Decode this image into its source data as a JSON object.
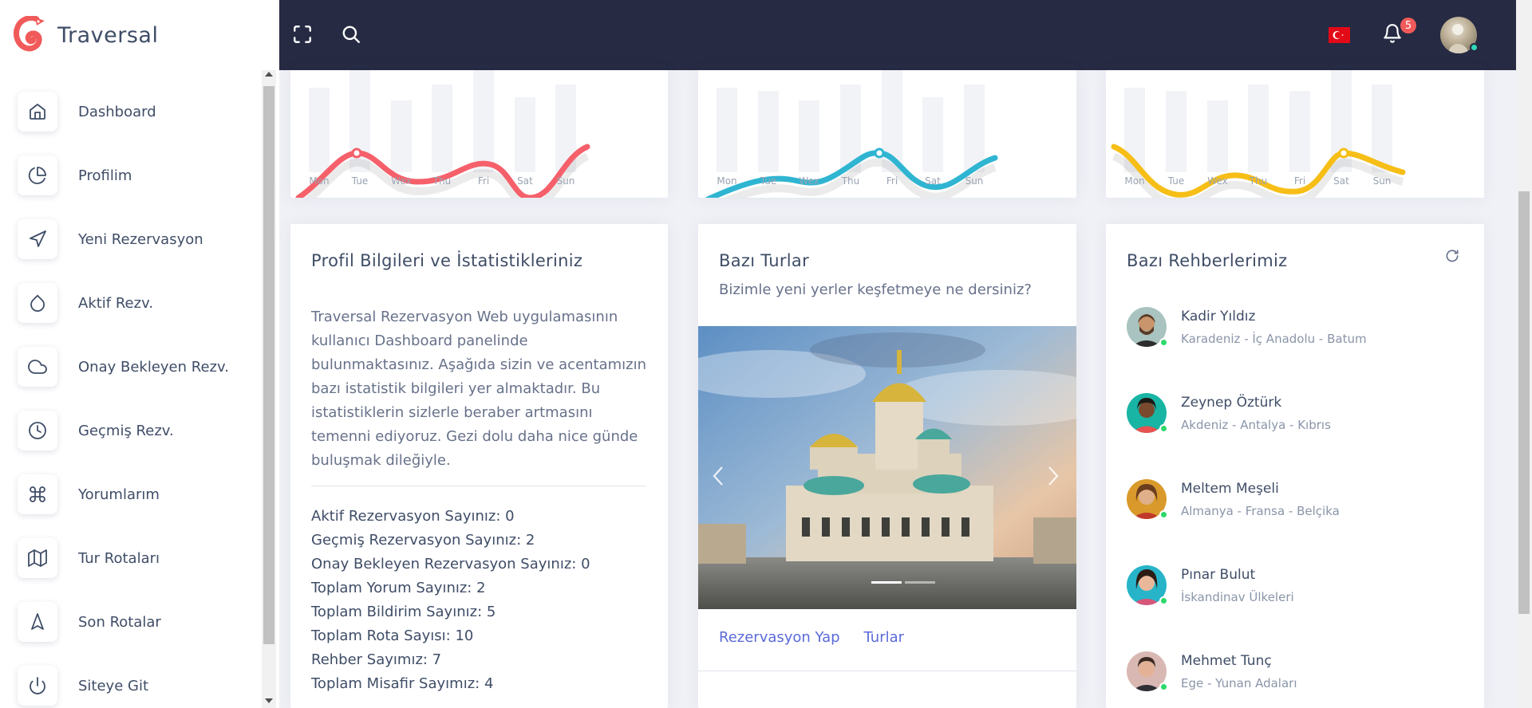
{
  "brand": {
    "name": "Traversal",
    "color": "#f15a5a"
  },
  "sidebar": {
    "items": [
      {
        "label": "Dashboard",
        "icon": "home-icon"
      },
      {
        "label": "Profilim",
        "icon": "pie-chart-icon"
      },
      {
        "label": "Yeni Rezervasyon",
        "icon": "navigation-icon"
      },
      {
        "label": "Aktif Rezv.",
        "icon": "droplet-icon"
      },
      {
        "label": "Onay Bekleyen Rezv.",
        "icon": "cloud-icon"
      },
      {
        "label": "Geçmiş Rezv.",
        "icon": "clock-icon"
      },
      {
        "label": "Yorumlarım",
        "icon": "command-icon"
      },
      {
        "label": "Tur Rotaları",
        "icon": "map-icon"
      },
      {
        "label": "Son Rotalar",
        "icon": "navigation-2-icon"
      },
      {
        "label": "Siteye Git",
        "icon": "power-icon"
      }
    ]
  },
  "header": {
    "fullscreen_icon": "fullscreen-icon",
    "search_icon": "search-icon",
    "flag_icon": "turkey-flag-icon",
    "notification_count": "5",
    "bg_color": "#262a43"
  },
  "charts": [
    {
      "color": "#f5606a",
      "days": [
        "Mon",
        "Tue",
        "Wex",
        "Thu",
        "Fri",
        "Sat",
        "Sun"
      ]
    },
    {
      "color": "#2fb5d2",
      "days": [
        "Mon",
        "Tue",
        "Wex",
        "Thu",
        "Fri",
        "Sat",
        "Sun"
      ]
    },
    {
      "color": "#f6be16",
      "days": [
        "Mon",
        "Tue",
        "Wex",
        "Thu",
        "Fri",
        "Sat",
        "Sun"
      ]
    }
  ],
  "profile_card": {
    "title": "Profil Bilgileri ve İstatistikleriniz",
    "text": "Traversal Rezervasyon Web uygulamasının kullanıcı Dashboard panelinde bulunmaktasınız. Aşağıda sizin ve acentamızın bazı istatistik bilgileri yer almaktadır. Bu istatistiklerin sizlerle beraber artmasını temenni ediyoruz. Gezi dolu daha nice günde buluşmak dileğiyle.",
    "stats": [
      "Aktif Rezervasyon Sayınız: 0",
      "Geçmiş Rezervasyon Sayınız: 2",
      "Onay Bekleyen Rezervasyon Sayınız: 0",
      "Toplam Yorum Sayınız: 2",
      "Toplam Bildirim Sayınız: 5",
      "Toplam Rota Sayısı: 10",
      "Rehber Sayımız: 7",
      "Toplam Misafir Sayımız: 4"
    ]
  },
  "tours_card": {
    "title": "Bazı Turlar",
    "subtitle": "Bizimle yeni yerler keşfetmeye ne dersiniz?",
    "links": [
      "Rezervasyon Yap",
      "Turlar"
    ]
  },
  "guides_card": {
    "title": "Bazı Rehberlerimiz",
    "refresh_icon": "refresh-icon",
    "guides": [
      {
        "name": "Kadir Yıldız",
        "route": "Karadeniz - İç Anadolu - Batum"
      },
      {
        "name": "Zeynep Öztürk",
        "route": "Akdeniz - Antalya - Kıbrıs"
      },
      {
        "name": "Meltem Meşeli",
        "route": "Almanya - Fransa - Belçika"
      },
      {
        "name": "Pınar Bulut",
        "route": "İskandinav Ülkeleri"
      },
      {
        "name": "Mehmet Tunç",
        "route": "Ege - Yunan Adaları"
      }
    ]
  }
}
